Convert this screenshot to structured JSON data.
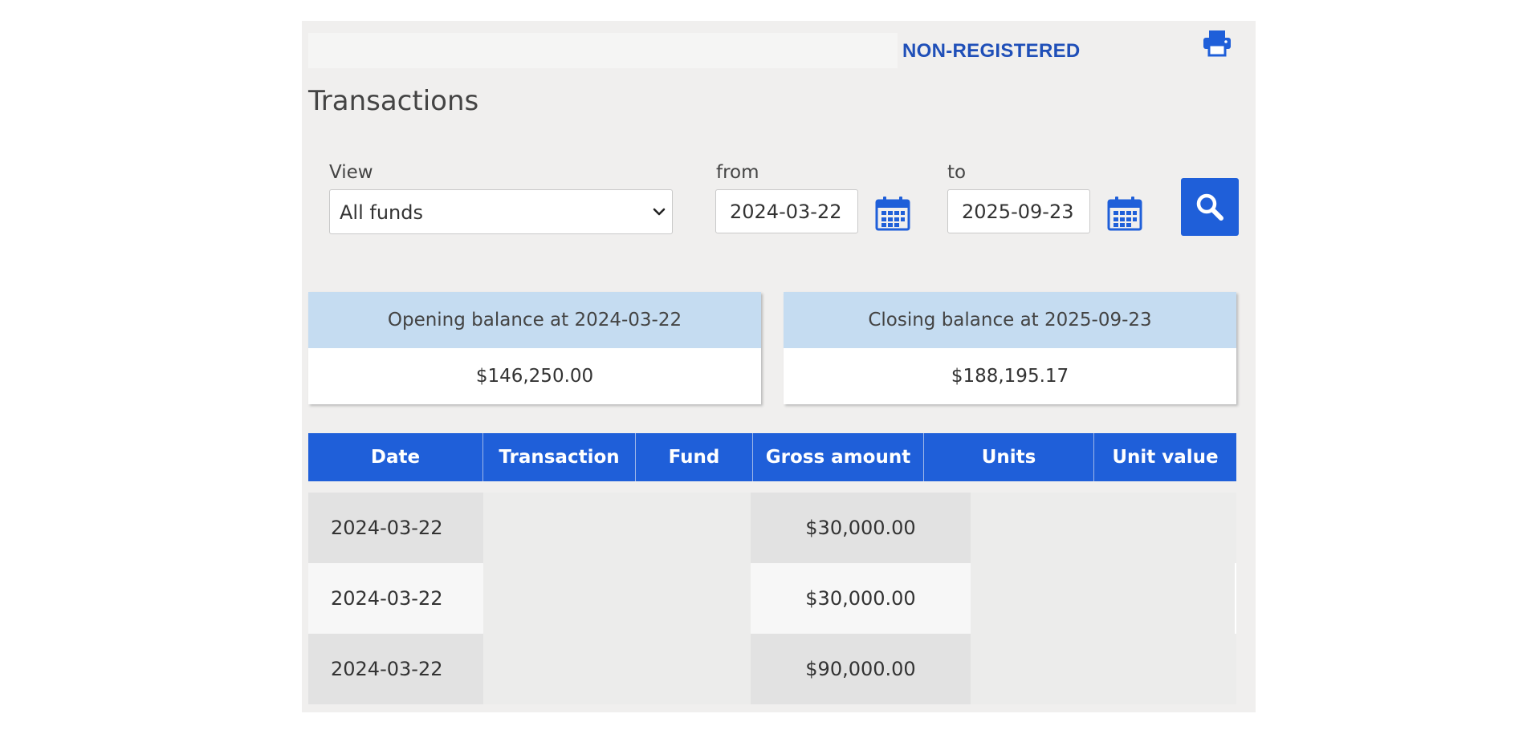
{
  "header": {
    "account_type": "NON-REGISTERED",
    "print_icon": "printer-icon"
  },
  "page_title": "Transactions",
  "filters": {
    "view_label": "View",
    "view_value": "All funds",
    "from_label": "from",
    "from_value": "2024-03-22",
    "to_label": "to",
    "to_value": "2025-09-23",
    "calendar_icon": "calendar-icon",
    "search_icon": "search-icon"
  },
  "balances": {
    "opening_label": "Opening balance at 2024-03-22",
    "opening_value": "$146,250.00",
    "closing_label": "Closing balance at 2025-09-23",
    "closing_value": "$188,195.17"
  },
  "table": {
    "headers": [
      "Date",
      "Transaction",
      "Fund",
      "Gross amount",
      "Units",
      "Unit value"
    ],
    "rows": [
      {
        "date": "2024-03-22",
        "gross": "$30,000.00"
      },
      {
        "date": "2024-03-22",
        "gross": "$30,000.00"
      },
      {
        "date": "2024-03-22",
        "gross": "$90,000.00"
      }
    ]
  },
  "colors": {
    "accent": "#1f5fd9",
    "brand_text": "#1f4fb8",
    "balance_header": "#c5dcf1",
    "panel_bg": "#f0efee"
  }
}
